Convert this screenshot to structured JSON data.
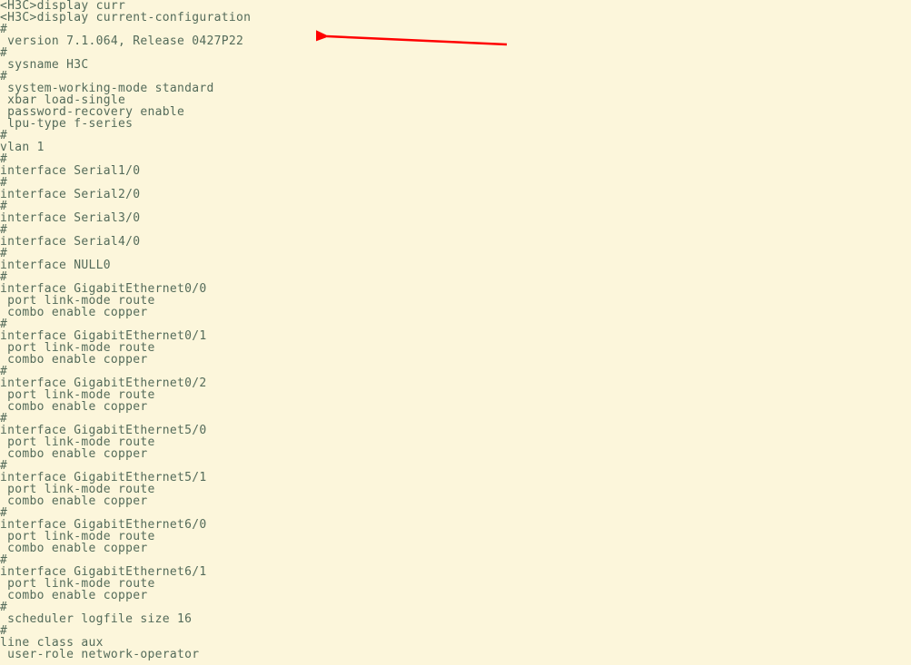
{
  "terminal": {
    "lines": [
      "<H3C>display curr",
      "<H3C>display current-configuration",
      "#",
      " version 7.1.064, Release 0427P22",
      "#",
      " sysname H3C",
      "#",
      " system-working-mode standard",
      " xbar load-single",
      " password-recovery enable",
      " lpu-type f-series",
      "#",
      "vlan 1",
      "#",
      "interface Serial1/0",
      "#",
      "interface Serial2/0",
      "#",
      "interface Serial3/0",
      "#",
      "interface Serial4/0",
      "#",
      "interface NULL0",
      "#",
      "interface GigabitEthernet0/0",
      " port link-mode route",
      " combo enable copper",
      "#",
      "interface GigabitEthernet0/1",
      " port link-mode route",
      " combo enable copper",
      "#",
      "interface GigabitEthernet0/2",
      " port link-mode route",
      " combo enable copper",
      "#",
      "interface GigabitEthernet5/0",
      " port link-mode route",
      " combo enable copper",
      "#",
      "interface GigabitEthernet5/1",
      " port link-mode route",
      " combo enable copper",
      "#",
      "interface GigabitEthernet6/0",
      " port link-mode route",
      " combo enable copper",
      "#",
      "interface GigabitEthernet6/1",
      " port link-mode route",
      " combo enable copper",
      "#",
      " scheduler logfile size 16",
      "#",
      "line class aux",
      " user-role network-operator"
    ]
  },
  "annotation": {
    "arrow_color": "#ff0000"
  }
}
